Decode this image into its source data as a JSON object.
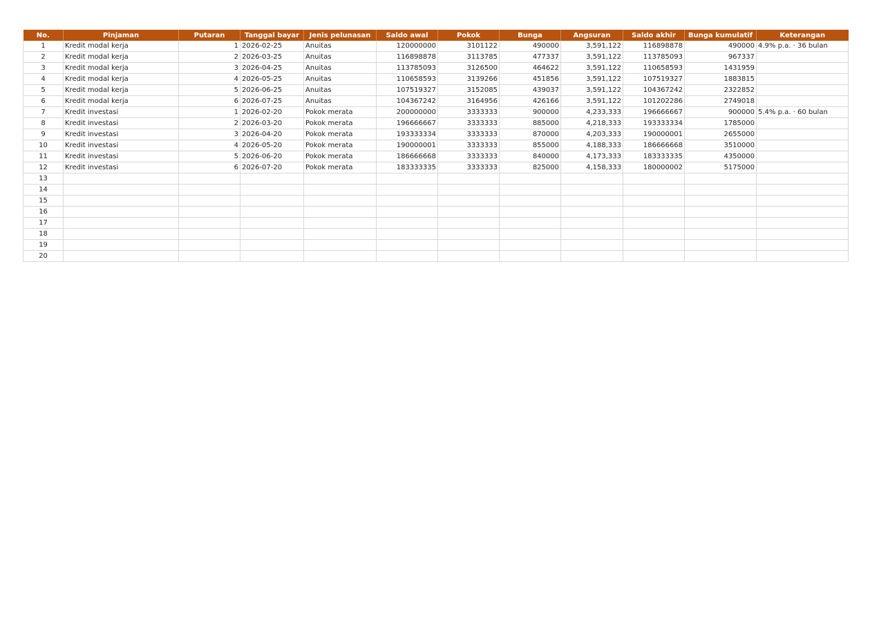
{
  "sheet": {
    "headers": [
      "No.",
      "Pinjaman",
      "Putaran",
      "Tanggal bayar",
      "Jenis pelunasan",
      "Saldo awal",
      "Pokok",
      "Bunga",
      "Angsuran",
      "Saldo akhir",
      "Bunga kumulatif",
      "Keterangan"
    ],
    "rows": [
      [
        "1",
        "Kredit modal kerja",
        "1",
        "2026-02-25",
        "Anuitas",
        "120000000",
        "3101122",
        "490000",
        "3,591,122",
        "116898878",
        "490000",
        "4.9% p.a. · 36 bulan"
      ],
      [
        "2",
        "Kredit modal kerja",
        "2",
        "2026-03-25",
        "Anuitas",
        "116898878",
        "3113785",
        "477337",
        "3,591,122",
        "113785093",
        "967337",
        ""
      ],
      [
        "3",
        "Kredit modal kerja",
        "3",
        "2026-04-25",
        "Anuitas",
        "113785093",
        "3126500",
        "464622",
        "3,591,122",
        "110658593",
        "1431959",
        ""
      ],
      [
        "4",
        "Kredit modal kerja",
        "4",
        "2026-05-25",
        "Anuitas",
        "110658593",
        "3139266",
        "451856",
        "3,591,122",
        "107519327",
        "1883815",
        ""
      ],
      [
        "5",
        "Kredit modal kerja",
        "5",
        "2026-06-25",
        "Anuitas",
        "107519327",
        "3152085",
        "439037",
        "3,591,122",
        "104367242",
        "2322852",
        ""
      ],
      [
        "6",
        "Kredit modal kerja",
        "6",
        "2026-07-25",
        "Anuitas",
        "104367242",
        "3164956",
        "426166",
        "3,591,122",
        "101202286",
        "2749018",
        ""
      ],
      [
        "7",
        "Kredit investasi",
        "1",
        "2026-02-20",
        "Pokok merata",
        "200000000",
        "3333333",
        "900000",
        "4,233,333",
        "196666667",
        "900000",
        "5.4% p.a. · 60 bulan"
      ],
      [
        "8",
        "Kredit investasi",
        "2",
        "2026-03-20",
        "Pokok merata",
        "196666667",
        "3333333",
        "885000",
        "4,218,333",
        "193333334",
        "1785000",
        ""
      ],
      [
        "9",
        "Kredit investasi",
        "3",
        "2026-04-20",
        "Pokok merata",
        "193333334",
        "3333333",
        "870000",
        "4,203,333",
        "190000001",
        "2655000",
        ""
      ],
      [
        "10",
        "Kredit investasi",
        "4",
        "2026-05-20",
        "Pokok merata",
        "190000001",
        "3333333",
        "855000",
        "4,188,333",
        "186666668",
        "3510000",
        ""
      ],
      [
        "11",
        "Kredit investasi",
        "5",
        "2026-06-20",
        "Pokok merata",
        "186666668",
        "3333333",
        "840000",
        "4,173,333",
        "183333335",
        "4350000",
        ""
      ],
      [
        "12",
        "Kredit investasi",
        "6",
        "2026-07-20",
        "Pokok merata",
        "183333335",
        "3333333",
        "825000",
        "4,158,333",
        "180000002",
        "5175000",
        ""
      ],
      [
        "13",
        "",
        "",
        "",
        "",
        "",
        "",
        "",
        "",
        "",
        "",
        ""
      ],
      [
        "14",
        "",
        "",
        "",
        "",
        "",
        "",
        "",
        "",
        "",
        "",
        ""
      ],
      [
        "15",
        "",
        "",
        "",
        "",
        "",
        "",
        "",
        "",
        "",
        "",
        ""
      ],
      [
        "16",
        "",
        "",
        "",
        "",
        "",
        "",
        "",
        "",
        "",
        "",
        ""
      ],
      [
        "17",
        "",
        "",
        "",
        "",
        "",
        "",
        "",
        "",
        "",
        "",
        ""
      ],
      [
        "18",
        "",
        "",
        "",
        "",
        "",
        "",
        "",
        "",
        "",
        "",
        ""
      ],
      [
        "19",
        "",
        "",
        "",
        "",
        "",
        "",
        "",
        "",
        "",
        "",
        ""
      ],
      [
        "20",
        "",
        "",
        "",
        "",
        "",
        "",
        "",
        "",
        "",
        "",
        ""
      ]
    ]
  },
  "colors": {
    "header_bg": "#b85410",
    "header_text": "#ffffff",
    "grid": "#d8d8d8"
  }
}
